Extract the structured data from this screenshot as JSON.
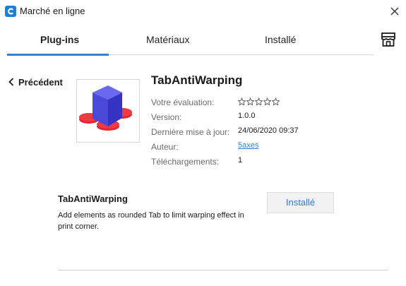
{
  "window": {
    "title": "Marché en ligne"
  },
  "tabs": [
    {
      "label": "Plug-ins",
      "active": true
    },
    {
      "label": "Matériaux",
      "active": false
    },
    {
      "label": "Installé",
      "active": false
    }
  ],
  "nav": {
    "back_label": "Précédent"
  },
  "plugin": {
    "name": "TabAntiWarping",
    "fields": [
      {
        "label": "Votre évaluation:",
        "value": ""
      },
      {
        "label": "Version:",
        "value": "1.0.0"
      },
      {
        "label": "Dernière mise à jour:",
        "value": "24/06/2020 09:37"
      },
      {
        "label": "Auteur:",
        "value": "5axes"
      },
      {
        "label": "Téléchargements:",
        "value": "1"
      }
    ],
    "rating": {
      "max": 5,
      "filled": 0
    },
    "description_title": "TabAntiWarping",
    "description": "Add elements as rounded Tab to limit warping effect in print corner.",
    "action_label": "Installé"
  },
  "icons": {
    "app": "cura-logo-icon",
    "close": "close-icon",
    "store": "storefront-icon",
    "back": "chevron-left-icon",
    "thumbnail": "cube-tabs-icon",
    "star": "star-outline-icon"
  },
  "colors": {
    "accent": "#3282dc",
    "divider": "#d6d6d6",
    "button_bg": "#f2f2f2",
    "muted_text": "#6b6b6b",
    "cube": "#4a48d8",
    "tabs": "#e8262f"
  }
}
